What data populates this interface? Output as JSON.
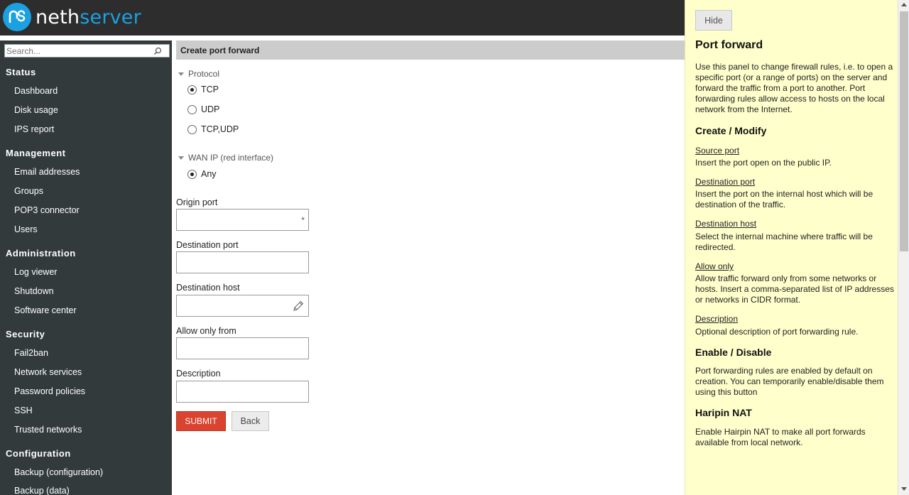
{
  "brand": {
    "name_part1": "neth",
    "name_part2": "server",
    "accent": "#1ba1e2"
  },
  "search": {
    "placeholder": "Search..."
  },
  "sidebar": {
    "groups": [
      {
        "title": "Status",
        "items": [
          "Dashboard",
          "Disk usage",
          "IPS report"
        ]
      },
      {
        "title": "Management",
        "items": [
          "Email addresses",
          "Groups",
          "POP3 connector",
          "Users"
        ]
      },
      {
        "title": "Administration",
        "items": [
          "Log viewer",
          "Shutdown",
          "Software center"
        ]
      },
      {
        "title": "Security",
        "items": [
          "Fail2ban",
          "Network services",
          "Password policies",
          "SSH",
          "Trusted networks"
        ]
      },
      {
        "title": "Configuration",
        "items": [
          "Backup (configuration)",
          "Backup (data)"
        ]
      }
    ]
  },
  "form": {
    "title": "Create port forward",
    "protocol": {
      "legend": "Protocol",
      "options": [
        "TCP",
        "UDP",
        "TCP,UDP"
      ],
      "selected": "TCP"
    },
    "wan": {
      "legend": "WAN IP (red interface)",
      "options": [
        "Any"
      ],
      "selected": "Any"
    },
    "fields": {
      "origin_port": {
        "label": "Origin port",
        "value": "",
        "required_mark": "*"
      },
      "destination_port": {
        "label": "Destination port",
        "value": ""
      },
      "destination_host": {
        "label": "Destination host",
        "value": ""
      },
      "allow_only_from": {
        "label": "Allow only from",
        "value": ""
      },
      "description": {
        "label": "Description",
        "value": ""
      }
    },
    "submit_label": "SUBMIT",
    "back_label": "Back",
    "colors": {
      "submit": "#d9432f"
    }
  },
  "help": {
    "hide_label": "Hide",
    "title": "Port forward",
    "intro": "Use this panel to change firewall rules, i.e. to open a specific port (or a range of ports) on the server and forward the traffic from a port to another. Port forwarding rules allow access to hosts on the local network from the Internet.",
    "create_heading": "Create / Modify",
    "terms": [
      {
        "term": "Source port",
        "desc": "Insert the port open on the public IP."
      },
      {
        "term": "Destination port",
        "desc": "Insert the port on the internal host which will be destination of the traffic."
      },
      {
        "term": "Destination host",
        "desc": "Select the internal machine where traffic will be redirected."
      },
      {
        "term": "Allow only",
        "desc": "Allow traffic forward only from some networks or hosts. Insert a comma-separated list of IP addresses or networks in CIDR format."
      },
      {
        "term": "Description",
        "desc": "Optional description of port forwarding rule."
      }
    ],
    "enable_heading": "Enable / Disable",
    "enable_text": "Port forwarding rules are enabled by default on creation. You can temporarily enable/disable them using this button",
    "haripin_heading": "Haripin NAT",
    "haripin_text": "Enable Hairpin NAT to make all port forwards available from local network.",
    "background": "#ffffcc"
  }
}
